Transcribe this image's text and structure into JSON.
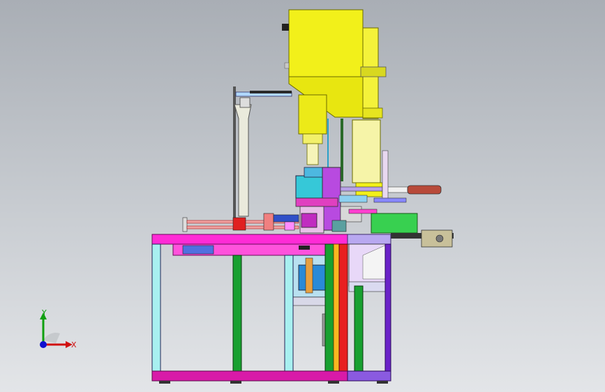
{
  "viewport": {
    "background_top": "#a9aeb5",
    "background_bottom": "#e3e5e8"
  },
  "triad": {
    "x_label": "X",
    "y_label": "Y",
    "x_color": "#d01010",
    "y_color": "#10a010",
    "z_color": "#1010d0"
  },
  "model": {
    "colors": {
      "frame_magenta": "#ff2bd6",
      "cylinder_yellow": "#f2f01a",
      "frame_purple": "#6a22c8",
      "leg_cyan": "#a8f0f0",
      "leg_green": "#18a030",
      "leg_red": "#e82020",
      "base_magenta": "#d81aa8",
      "plate_green": "#38d050"
    }
  }
}
